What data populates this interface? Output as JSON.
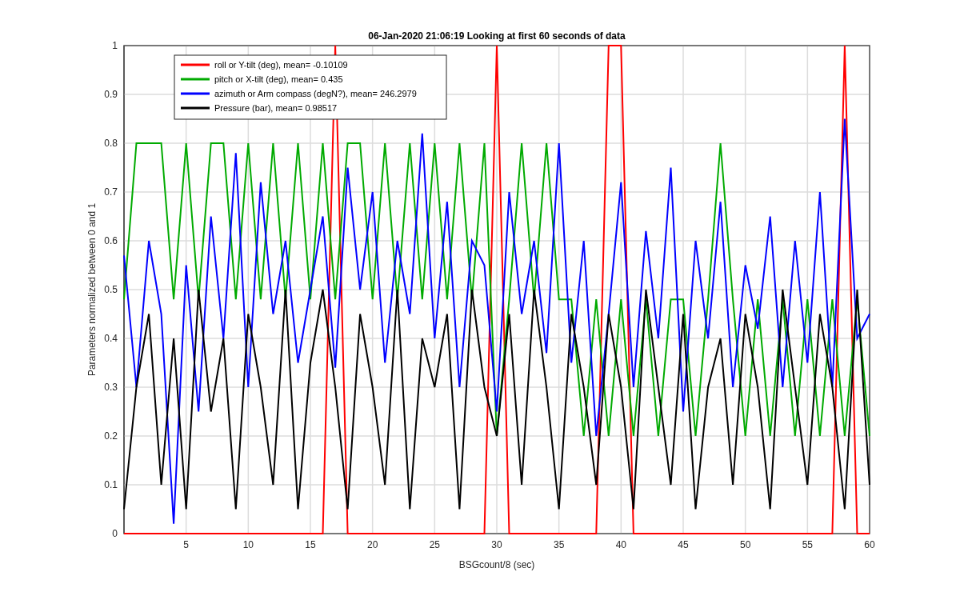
{
  "chart_data": {
    "type": "line",
    "title": "06-Jan-2020 21:06:19 Looking at first 60 seconds of data",
    "xlabel": "BSGcount/8 (sec)",
    "ylabel": "Parameters normalized between 0 and 1",
    "x": [
      0,
      1,
      2,
      3,
      4,
      5,
      6,
      7,
      8,
      9,
      10,
      11,
      12,
      13,
      14,
      15,
      16,
      17,
      18,
      19,
      20,
      21,
      22,
      23,
      24,
      25,
      26,
      27,
      28,
      29,
      30,
      31,
      32,
      33,
      34,
      35,
      36,
      37,
      38,
      39,
      40,
      41,
      42,
      43,
      44,
      45,
      46,
      47,
      48,
      49,
      50,
      51,
      52,
      53,
      54,
      55,
      56,
      57,
      58,
      59,
      60
    ],
    "series": [
      {
        "name": "roll or Y-tilt (deg), mean= -0.10109",
        "color": "#ff0000",
        "values": [
          0,
          0,
          0,
          0,
          0,
          0,
          0,
          0,
          0,
          0,
          0,
          0,
          0,
          0,
          0,
          0,
          0,
          1,
          0,
          0,
          0,
          0,
          0,
          0,
          0,
          0,
          0,
          0,
          0,
          0,
          1,
          0,
          0,
          0,
          0,
          0,
          0,
          0,
          0,
          1,
          1,
          0,
          0,
          0,
          0,
          0,
          0,
          0,
          0,
          0,
          0,
          0,
          0,
          0,
          0,
          0,
          0,
          0,
          1,
          0,
          0
        ]
      },
      {
        "name": "pitch or X-tilt (deg), mean= 0.435",
        "color": "#00aa00",
        "values": [
          0.48,
          0.8,
          0.8,
          0.8,
          0.48,
          0.8,
          0.48,
          0.8,
          0.8,
          0.48,
          0.8,
          0.48,
          0.8,
          0.48,
          0.8,
          0.48,
          0.8,
          0.48,
          0.8,
          0.8,
          0.48,
          0.8,
          0.48,
          0.8,
          0.48,
          0.8,
          0.48,
          0.8,
          0.48,
          0.8,
          0.2,
          0.48,
          0.8,
          0.48,
          0.8,
          0.48,
          0.48,
          0.2,
          0.48,
          0.2,
          0.48,
          0.2,
          0.48,
          0.2,
          0.48,
          0.48,
          0.2,
          0.48,
          0.8,
          0.48,
          0.2,
          0.48,
          0.2,
          0.48,
          0.2,
          0.48,
          0.2,
          0.48,
          0.2,
          0.48,
          0.2
        ]
      },
      {
        "name": "azimuth or Arm compass (degN?), mean= 246.2979",
        "color": "#0000ff",
        "values": [
          0.57,
          0.3,
          0.6,
          0.45,
          0.02,
          0.55,
          0.25,
          0.65,
          0.4,
          0.78,
          0.3,
          0.72,
          0.45,
          0.6,
          0.35,
          0.5,
          0.65,
          0.34,
          0.75,
          0.5,
          0.7,
          0.35,
          0.6,
          0.45,
          0.82,
          0.4,
          0.68,
          0.3,
          0.6,
          0.55,
          0.25,
          0.7,
          0.45,
          0.6,
          0.37,
          0.8,
          0.35,
          0.6,
          0.2,
          0.45,
          0.72,
          0.3,
          0.62,
          0.4,
          0.75,
          0.25,
          0.6,
          0.4,
          0.68,
          0.3,
          0.55,
          0.42,
          0.65,
          0.3,
          0.6,
          0.35,
          0.7,
          0.3,
          0.85,
          0.4,
          0.45
        ]
      },
      {
        "name": "Pressure (bar), mean= 0.98517",
        "color": "#000000",
        "values": [
          0.05,
          0.3,
          0.45,
          0.1,
          0.4,
          0.05,
          0.5,
          0.25,
          0.4,
          0.05,
          0.45,
          0.3,
          0.1,
          0.5,
          0.05,
          0.35,
          0.5,
          0.3,
          0.05,
          0.45,
          0.3,
          0.1,
          0.5,
          0.05,
          0.4,
          0.3,
          0.45,
          0.05,
          0.5,
          0.3,
          0.2,
          0.45,
          0.1,
          0.5,
          0.3,
          0.05,
          0.45,
          0.3,
          0.1,
          0.45,
          0.3,
          0.05,
          0.5,
          0.3,
          0.1,
          0.45,
          0.05,
          0.3,
          0.4,
          0.1,
          0.45,
          0.3,
          0.05,
          0.5,
          0.3,
          0.1,
          0.45,
          0.3,
          0.05,
          0.5,
          0.1
        ]
      }
    ],
    "grid": true,
    "legend": true,
    "xlim": [
      0,
      60
    ],
    "ylim": [
      0,
      1
    ],
    "xticks": [
      5,
      10,
      15,
      20,
      25,
      30,
      35,
      40,
      45,
      50,
      55,
      60
    ],
    "yticks": [
      0,
      0.1,
      0.2,
      0.3,
      0.4,
      0.5,
      0.6,
      0.7,
      0.8,
      0.9,
      1
    ]
  }
}
